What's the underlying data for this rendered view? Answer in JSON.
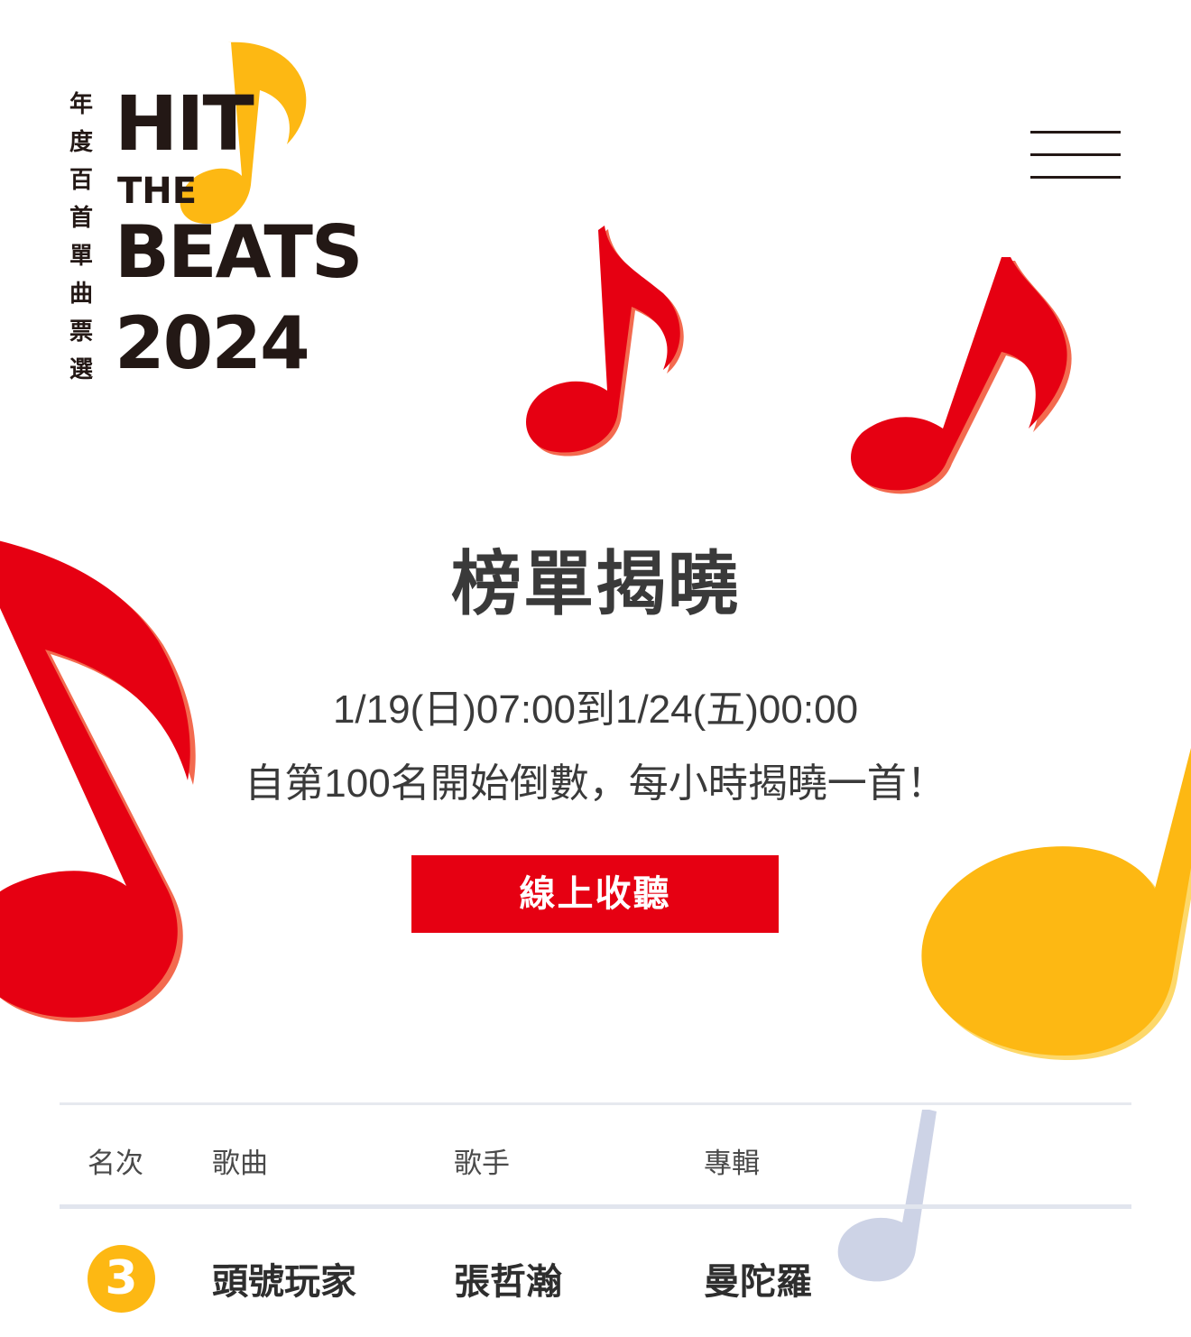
{
  "colors": {
    "brand_red": "#e60012",
    "brand_yellow": "#fdb813",
    "text_dark": "#231815",
    "faint_note": "#cdd3e6"
  },
  "logo": {
    "vertical_chars": [
      "年",
      "度",
      "百",
      "首",
      "單",
      "曲",
      "票",
      "選"
    ],
    "line1": "HIT",
    "line2": "THE",
    "line3": "BEATS",
    "line4": "2024",
    "icon": "music-note-icon"
  },
  "menu": {
    "icon": "hamburger-menu-icon"
  },
  "hero": {
    "title": "榜單揭曉",
    "date_line": "1/19(日)07:00到1/24(五)00:00",
    "desc_line": "自第100名開始倒數，每小時揭曉一首！",
    "listen_button": "線上收聽"
  },
  "table": {
    "headers": {
      "rank": "名次",
      "song": "歌曲",
      "artist": "歌手",
      "album": "專輯"
    },
    "rows": [
      {
        "rank": "3",
        "song": "頭號玩家",
        "artist": "張哲瀚",
        "album": "曼陀羅"
      }
    ]
  }
}
